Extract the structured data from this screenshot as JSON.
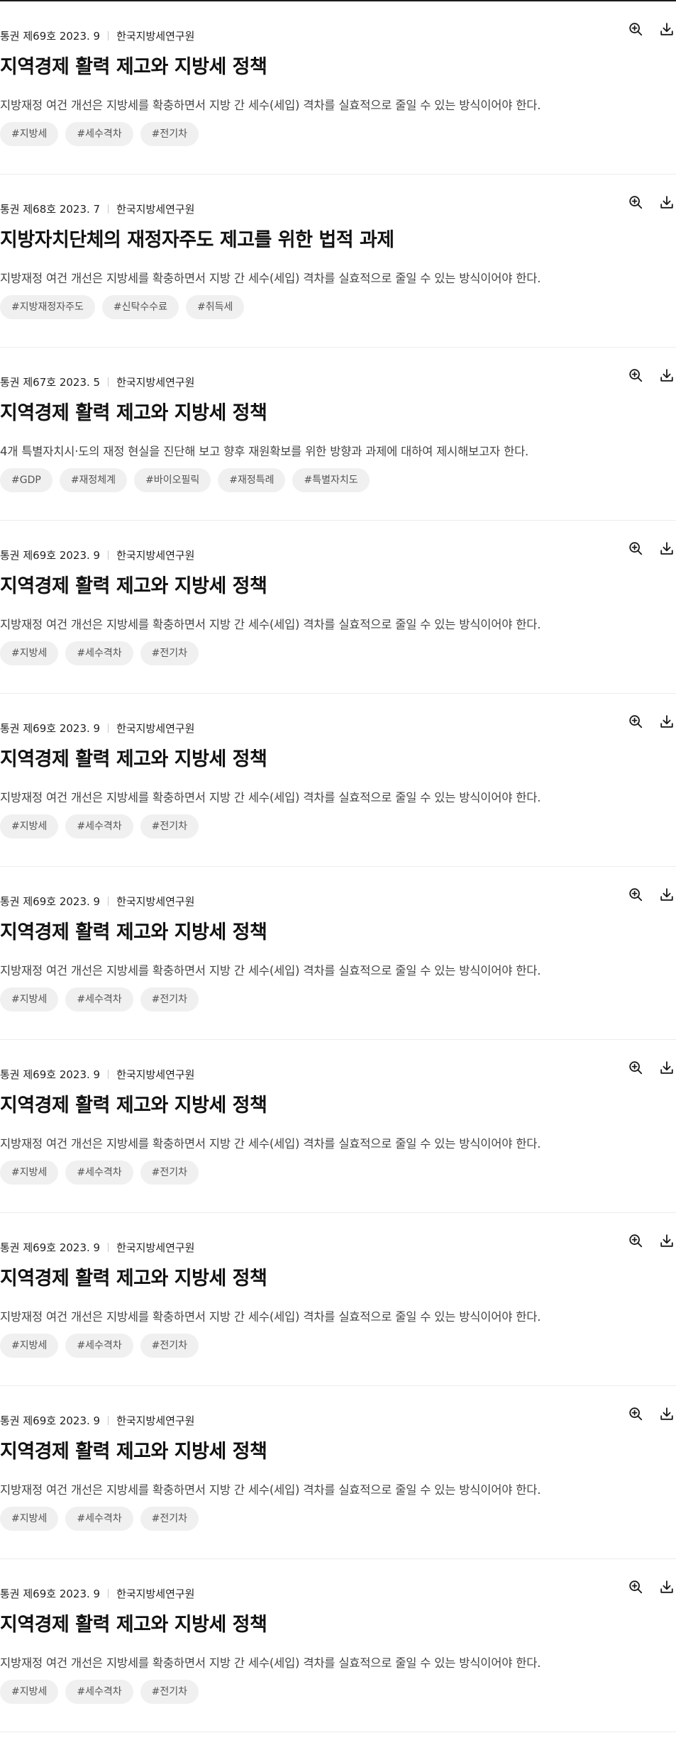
{
  "icons": {
    "zoom": "zoom-in-icon",
    "download": "download-icon"
  },
  "items": [
    {
      "volume": "통권 제69호 2023. 9",
      "publisher": "한국지방세연구원",
      "title": "지역경제 활력 제고와 지방세 정책",
      "summary": "지방재정 여건 개선은 지방세를 확충하면서 지방 간 세수(세입) 격차를 실효적으로 줄일 수 있는 방식이어야 한다.",
      "tags": [
        "#지방세",
        "#세수격차",
        "#전기차"
      ]
    },
    {
      "volume": "통권 제68호 2023. 7",
      "publisher": "한국지방세연구원",
      "title": "지방자치단체의 재정자주도 제고를 위한 법적 과제",
      "summary": "지방재정 여건 개선은 지방세를 확충하면서 지방 간 세수(세입) 격차를 실효적으로 줄일 수 있는 방식이어야 한다.",
      "tags": [
        "#지방재정자주도",
        "#신탁수수료",
        "#취득세"
      ]
    },
    {
      "volume": "통권 제67호 2023. 5",
      "publisher": "한국지방세연구원",
      "title": "지역경제 활력 제고와 지방세 정책",
      "summary": "4개 특별자치시·도의 재정 현실을 진단해 보고 향후 재원확보를 위한 방향과 과제에 대하여 제시해보고자 한다.",
      "tags": [
        "#GDP",
        "#재정체계",
        "#바이오필릭",
        "#재정특례",
        "#특별자치도"
      ]
    },
    {
      "volume": "통권 제69호 2023. 9",
      "publisher": "한국지방세연구원",
      "title": "지역경제 활력 제고와 지방세 정책",
      "summary": "지방재정 여건 개선은 지방세를 확충하면서 지방 간 세수(세입) 격차를 실효적으로 줄일 수 있는 방식이어야 한다.",
      "tags": [
        "#지방세",
        "#세수격차",
        "#전기차"
      ]
    },
    {
      "volume": "통권 제69호 2023. 9",
      "publisher": "한국지방세연구원",
      "title": "지역경제 활력 제고와 지방세 정책",
      "summary": "지방재정 여건 개선은 지방세를 확충하면서 지방 간 세수(세입) 격차를 실효적으로 줄일 수 있는 방식이어야 한다.",
      "tags": [
        "#지방세",
        "#세수격차",
        "#전기차"
      ]
    },
    {
      "volume": "통권 제69호 2023. 9",
      "publisher": "한국지방세연구원",
      "title": "지역경제 활력 제고와 지방세 정책",
      "summary": "지방재정 여건 개선은 지방세를 확충하면서 지방 간 세수(세입) 격차를 실효적으로 줄일 수 있는 방식이어야 한다.",
      "tags": [
        "#지방세",
        "#세수격차",
        "#전기차"
      ]
    },
    {
      "volume": "통권 제69호 2023. 9",
      "publisher": "한국지방세연구원",
      "title": "지역경제 활력 제고와 지방세 정책",
      "summary": "지방재정 여건 개선은 지방세를 확충하면서 지방 간 세수(세입) 격차를 실효적으로 줄일 수 있는 방식이어야 한다.",
      "tags": [
        "#지방세",
        "#세수격차",
        "#전기차"
      ]
    },
    {
      "volume": "통권 제69호 2023. 9",
      "publisher": "한국지방세연구원",
      "title": "지역경제 활력 제고와 지방세 정책",
      "summary": "지방재정 여건 개선은 지방세를 확충하면서 지방 간 세수(세입) 격차를 실효적으로 줄일 수 있는 방식이어야 한다.",
      "tags": [
        "#지방세",
        "#세수격차",
        "#전기차"
      ]
    },
    {
      "volume": "통권 제69호 2023. 9",
      "publisher": "한국지방세연구원",
      "title": "지역경제 활력 제고와 지방세 정책",
      "summary": "지방재정 여건 개선은 지방세를 확충하면서 지방 간 세수(세입) 격차를 실효적으로 줄일 수 있는 방식이어야 한다.",
      "tags": [
        "#지방세",
        "#세수격차",
        "#전기차"
      ]
    },
    {
      "volume": "통권 제69호 2023. 9",
      "publisher": "한국지방세연구원",
      "title": "지역경제 활력 제고와 지방세 정책",
      "summary": "지방재정 여건 개선은 지방세를 확충하면서 지방 간 세수(세입) 격차를 실효적으로 줄일 수 있는 방식이어야 한다.",
      "tags": [
        "#지방세",
        "#세수격차",
        "#전기차"
      ]
    }
  ]
}
